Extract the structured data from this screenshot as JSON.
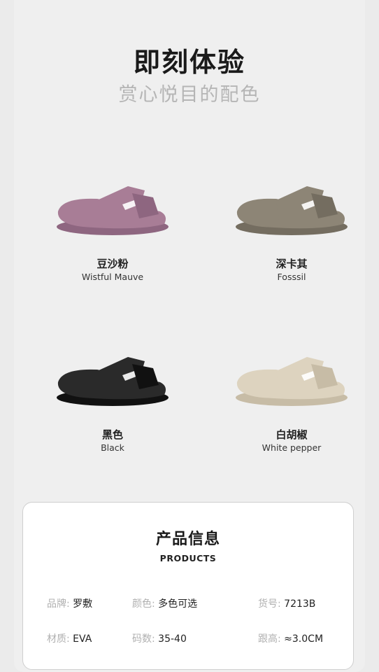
{
  "header": {
    "title": "即刻体验",
    "subtitle": "赏心悦目的配色"
  },
  "products": [
    {
      "name_cn": "豆沙粉",
      "name_en": "Wistful Mauve",
      "color": "#a87d96",
      "shade": "#8e6680"
    },
    {
      "name_cn": "深卡其",
      "name_en": "Fosssil",
      "color": "#8d8576",
      "shade": "#746d60"
    },
    {
      "name_cn": "黑色",
      "name_en": "Black",
      "color": "#2a2a2a",
      "shade": "#111111"
    },
    {
      "name_cn": "白胡椒",
      "name_en": "White pepper",
      "color": "#ddd3bf",
      "shade": "#c7bca6"
    }
  ],
  "info": {
    "title": "产品信息",
    "subtitle": "PRODUCTS",
    "specs": [
      {
        "key": "品牌:",
        "value": "罗敷"
      },
      {
        "key": "颜色:",
        "value": "多色可选"
      },
      {
        "key": "货号:",
        "value": "7213B"
      },
      {
        "key": "材质:",
        "value": "EVA"
      },
      {
        "key": "码数:",
        "value": "35-40"
      },
      {
        "key": "跟高:",
        "value": "≈3.0CM"
      }
    ]
  }
}
